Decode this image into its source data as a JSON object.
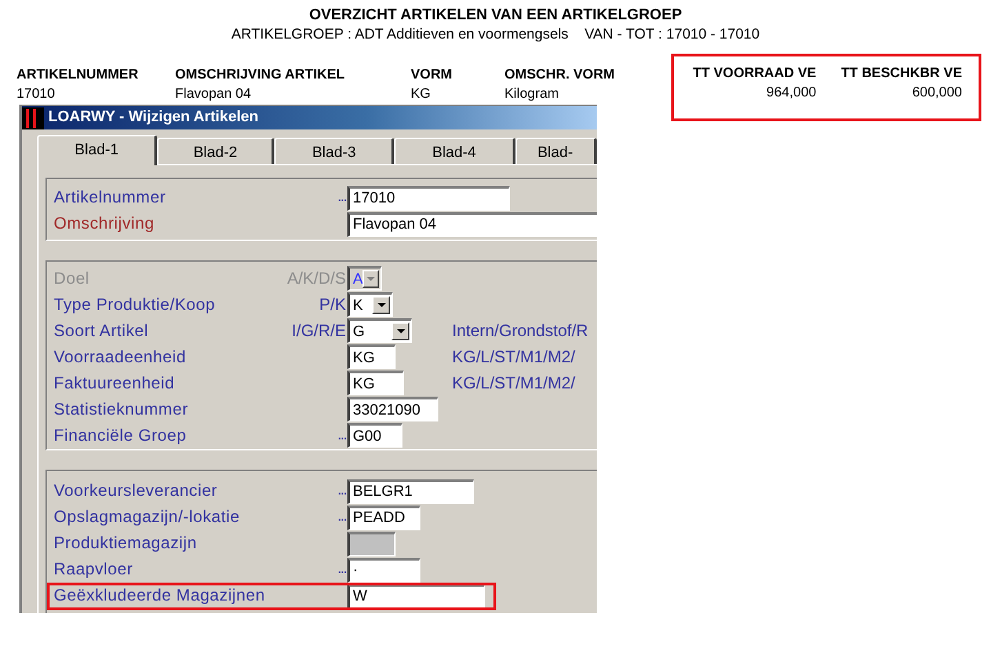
{
  "report": {
    "title": "OVERZICHT ARTIKELEN VAN EEN ARTIKELGROEP",
    "subtitle": "ARTIKELGROEP : ADT Additieven en voormengsels    VAN - TOT : 17010 - 17010",
    "columns": [
      "ARTIKELNUMMER",
      "OMSCHRIJVING ARTIKEL",
      "VORM",
      "OMSCHR. VORM"
    ],
    "row": [
      "17010",
      "Flavopan 04",
      "KG",
      "Kilogram"
    ],
    "totals": {
      "highlighted": true,
      "columns": [
        "TT VOORRAAD VE",
        "TT BESCHKBR VE"
      ],
      "values": [
        "964,000",
        "600,000"
      ]
    }
  },
  "window": {
    "title": "LOARWY - Wijzigen Artikelen",
    "tabs": [
      {
        "label": "Blad-1",
        "selected": true
      },
      {
        "label": "Blad-2",
        "selected": false
      },
      {
        "label": "Blad-3",
        "selected": false
      },
      {
        "label": "Blad-4",
        "selected": false
      },
      {
        "label": "Blad-",
        "selected": false
      }
    ],
    "groups": [
      [
        {
          "label": "Artikelnummer",
          "color": "#3232a0",
          "lookup": "...",
          "kind": "text",
          "value": "17010"
        },
        {
          "label": "Omschrijving",
          "color": "#a02828",
          "kind": "text",
          "value": "Flavopan 04"
        }
      ],
      [
        {
          "label": "Doel",
          "color": "#8c8c8c",
          "code": "A/K/D/S",
          "kind": "combo",
          "value": "A",
          "disabled": true
        },
        {
          "label": "Type Produktie/Koop",
          "color": "#3232a0",
          "code": "P/K",
          "kind": "combo",
          "value": "K",
          "disabled": false
        },
        {
          "label": "Soort Artikel",
          "color": "#3232a0",
          "code": "I/G/R/E",
          "kind": "combo",
          "value": "G",
          "disabled": false,
          "hint": "Intern/Grondstof/R"
        },
        {
          "label": "Voorraadeenheid",
          "color": "#3232a0",
          "kind": "text",
          "value": "KG",
          "hint": "KG/L/ST/M1/M2/"
        },
        {
          "label": "Faktuureenheid",
          "color": "#3232a0",
          "kind": "text",
          "value": "KG",
          "hint": "KG/L/ST/M1/M2/"
        },
        {
          "label": "Statistieknummer",
          "color": "#3232a0",
          "kind": "text",
          "value": "33021090"
        },
        {
          "label": "Financiële Groep",
          "color": "#3232a0",
          "lookup": "...",
          "kind": "text",
          "value": "G00"
        }
      ],
      [
        {
          "label": "Voorkeursleverancier",
          "color": "#3232a0",
          "lookup": "...",
          "kind": "text",
          "value": "BELGR1"
        },
        {
          "label": "Opslagmagazijn/-lokatie",
          "color": "#3232a0",
          "lookup": "...",
          "kind": "text",
          "value": "PEADD"
        },
        {
          "label": "Produktiemagazijn",
          "color": "#3232a0",
          "kind": "disabled"
        },
        {
          "label": "Raapvloer",
          "color": "#3232a0",
          "lookup": "...",
          "kind": "text",
          "value": "·"
        },
        {
          "label": "Geëxkludeerde Magazijnen",
          "color": "#3232a0",
          "kind": "text",
          "value": "W",
          "highlighted": true
        }
      ]
    ]
  }
}
